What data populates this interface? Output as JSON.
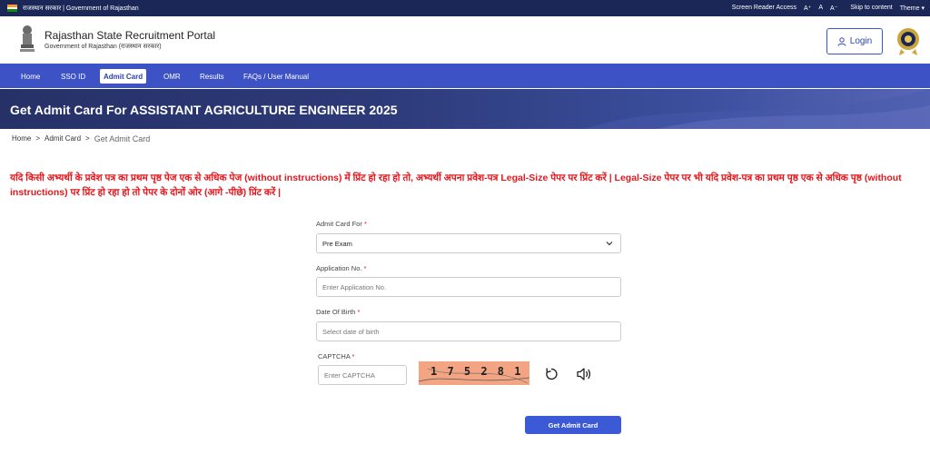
{
  "topbar": {
    "gov_text": "राजस्थान सरकार | Government of Rajasthan",
    "screen_reader": "Screen Reader Access",
    "font_a_plus": "A⁺",
    "font_a": "A",
    "font_a_minus": "A⁻",
    "skip": "Skip to content",
    "theme": "Theme"
  },
  "header": {
    "title": "Rajasthan State Recruitment Portal",
    "subtitle": "Government of Rajasthan (राजस्थान सरकार)",
    "login_label": "Login"
  },
  "nav": {
    "items": [
      {
        "label": "Home"
      },
      {
        "label": "SSO ID"
      },
      {
        "label": "Admit Card"
      },
      {
        "label": "OMR"
      },
      {
        "label": "Results"
      },
      {
        "label": "FAQs / User Manual"
      }
    ],
    "active": "Admit Card"
  },
  "banner": {
    "title": "Get Admit Card For ASSISTANT AGRICULTURE ENGINEER 2025"
  },
  "breadcrumb": {
    "home": "Home",
    "sep1": ">",
    "admit_card": "Admit Card",
    "sep2": ">",
    "current": "Get Admit Card"
  },
  "notice": {
    "line1": "यदि किसी अभ्यर्थी के प्रवेश पत्र का प्रथम पृष्ठ पेज एक से अधिक पेज (without instructions) में प्रिंट हो रहा हो तो, अभ्यर्थी अपना प्रवेश-पत्र Legal-Size पेपर पर प्रिंट करें | Legal-Size पेपर पर भी यदि प्रवेश-पत्र का प्रथम पृष्ठ एक से अधिक पृष्ठ (without",
    "line2": "instructions) पर प्रिंट हो रहा हो तो पेपर के दोनों ओर (आगे -पीछे) प्रिंट करें |"
  },
  "form": {
    "admit_for_label": "Admit Card For",
    "admit_for_value": "Pre Exam",
    "application_label": "Application No.",
    "application_placeholder": "Enter Application No.",
    "dob_label": "Date Of Birth",
    "dob_placeholder": "Select date of birth",
    "captcha_label": "CAPTCHA",
    "captcha_placeholder": "Enter CAPTCHA",
    "captcha_text": "1 7 5 2 8 1",
    "required_mark": "*",
    "submit_label": "Get Admit Card"
  },
  "colors": {
    "topbar": "#1b2756",
    "nav": "#3d52c4",
    "notice": "#e6171d",
    "submit": "#3d5ad6"
  },
  "icons": [
    "india-flag-icon",
    "state-emblem-icon",
    "user-icon",
    "recruitment-board-logo",
    "chevron-down-icon",
    "refresh-icon",
    "speaker-icon"
  ]
}
